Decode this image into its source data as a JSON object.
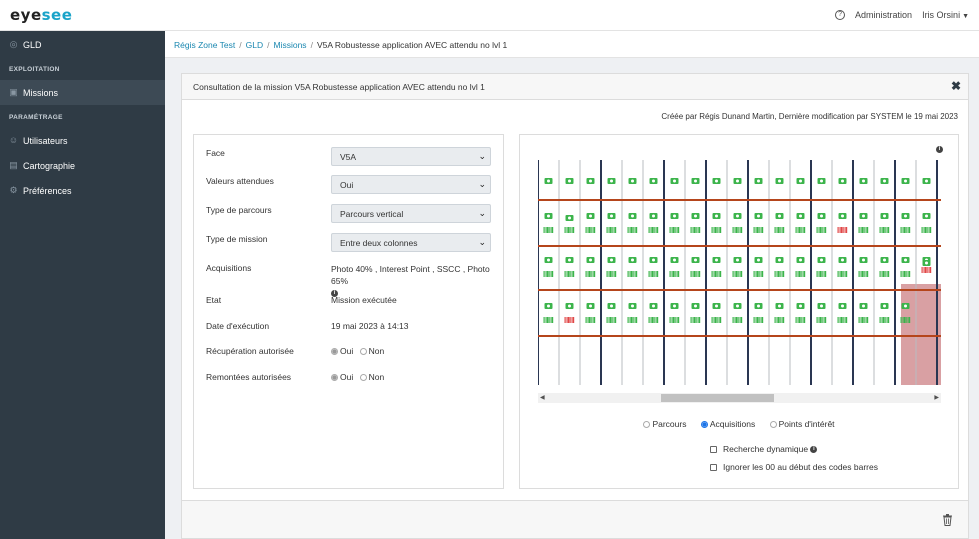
{
  "topbar": {
    "logo_main": "eye",
    "logo_accent": "see",
    "admin_label": "Administration",
    "user_name": "Iris Orsini"
  },
  "sidebar": {
    "top_item": "GLD",
    "section_exploitation": "EXPLOITATION",
    "missions": "Missions",
    "section_parametrage": "PARAMÉTRAGE",
    "utilisateurs": "Utilisateurs",
    "cartographie": "Cartographie",
    "preferences": "Préférences"
  },
  "breadcrumb": {
    "items": [
      "Régis Zone Test",
      "GLD",
      "Missions"
    ],
    "current": "V5A Robustesse application AVEC attendu no lvl 1"
  },
  "panel": {
    "title": "Consultation de la mission V5A Robustesse application AVEC attendu no lvl 1",
    "meta": "Créée par Régis Dunand Martin, Dernière modification par SYSTEM le 19 mai 2023"
  },
  "form": {
    "face_label": "Face",
    "face_value": "V5A",
    "valeurs_label": "Valeurs attendues",
    "valeurs_value": "Oui",
    "parcours_label": "Type de parcours",
    "parcours_value": "Parcours vertical",
    "mission_label": "Type de mission",
    "mission_value": "Entre deux colonnes",
    "acquisitions_label": "Acquisitions",
    "acquisitions_value": "Photo 40% , Interest Point , SSCC , Photo 65%",
    "etat_label": "Etat",
    "etat_value": "Mission exécutée",
    "date_label": "Date d'exécution",
    "date_value": "19 mai 2023 à 14:13",
    "recup_label": "Récupération autorisée",
    "remont_label": "Remontées autorisées",
    "oui": "Oui",
    "non": "Non"
  },
  "viz": {
    "opt_parcours": "Parcours",
    "opt_acquisitions": "Acquisitions",
    "opt_points": "Points d'intérêt",
    "check_recherche": "Recherche dynamique",
    "check_ignorer": "Ignorer les 00 au début des codes barres",
    "selected_option": "Acquisitions"
  },
  "colors": {
    "sidebar_bg": "#2f3b45",
    "accent": "#1aa3c8",
    "link": "#1a87b0",
    "ok_green": "#3cb44b",
    "error_red": "#e04848",
    "beam_orange": "#b5451b",
    "column_navy": "#2a3652"
  }
}
